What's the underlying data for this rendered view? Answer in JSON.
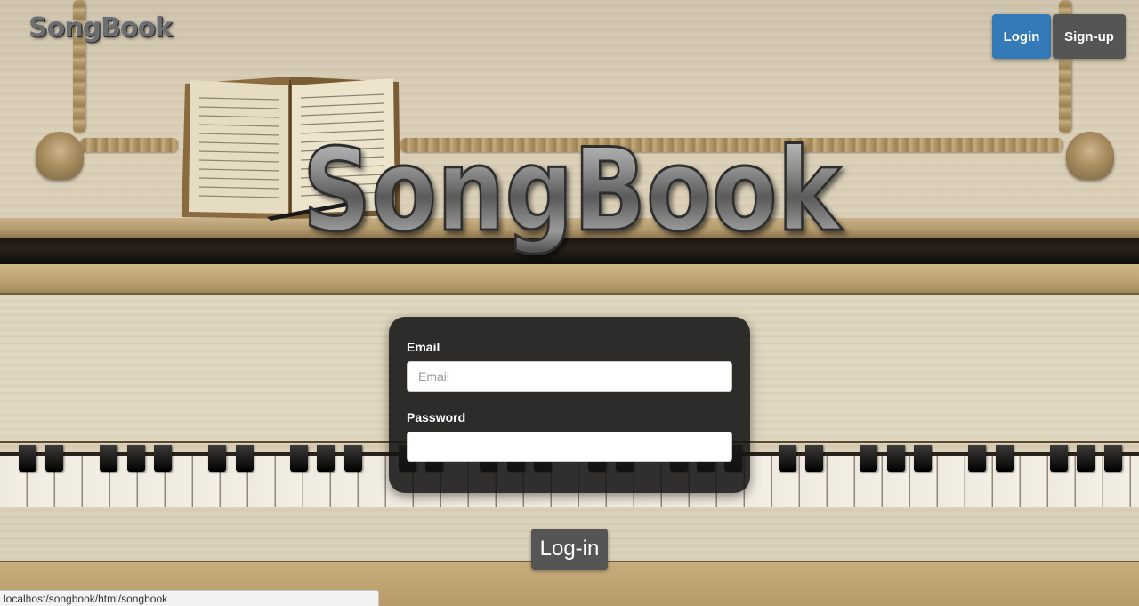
{
  "brand": {
    "small_logo": "SongBook",
    "hero_logo": "SongBook"
  },
  "nav": {
    "login_label": "Login",
    "signup_label": "Sign-up"
  },
  "login_form": {
    "email_label": "Email",
    "email_placeholder": "Email",
    "email_value": "",
    "password_label": "Password",
    "password_value": "",
    "submit_label": "Log-in"
  },
  "status_bar": {
    "url": "localhost/songbook/html/songbook"
  },
  "colors": {
    "login_button": "#337ab7",
    "signup_button": "#555555",
    "submit_button": "#555555",
    "card_background": "#141414"
  }
}
